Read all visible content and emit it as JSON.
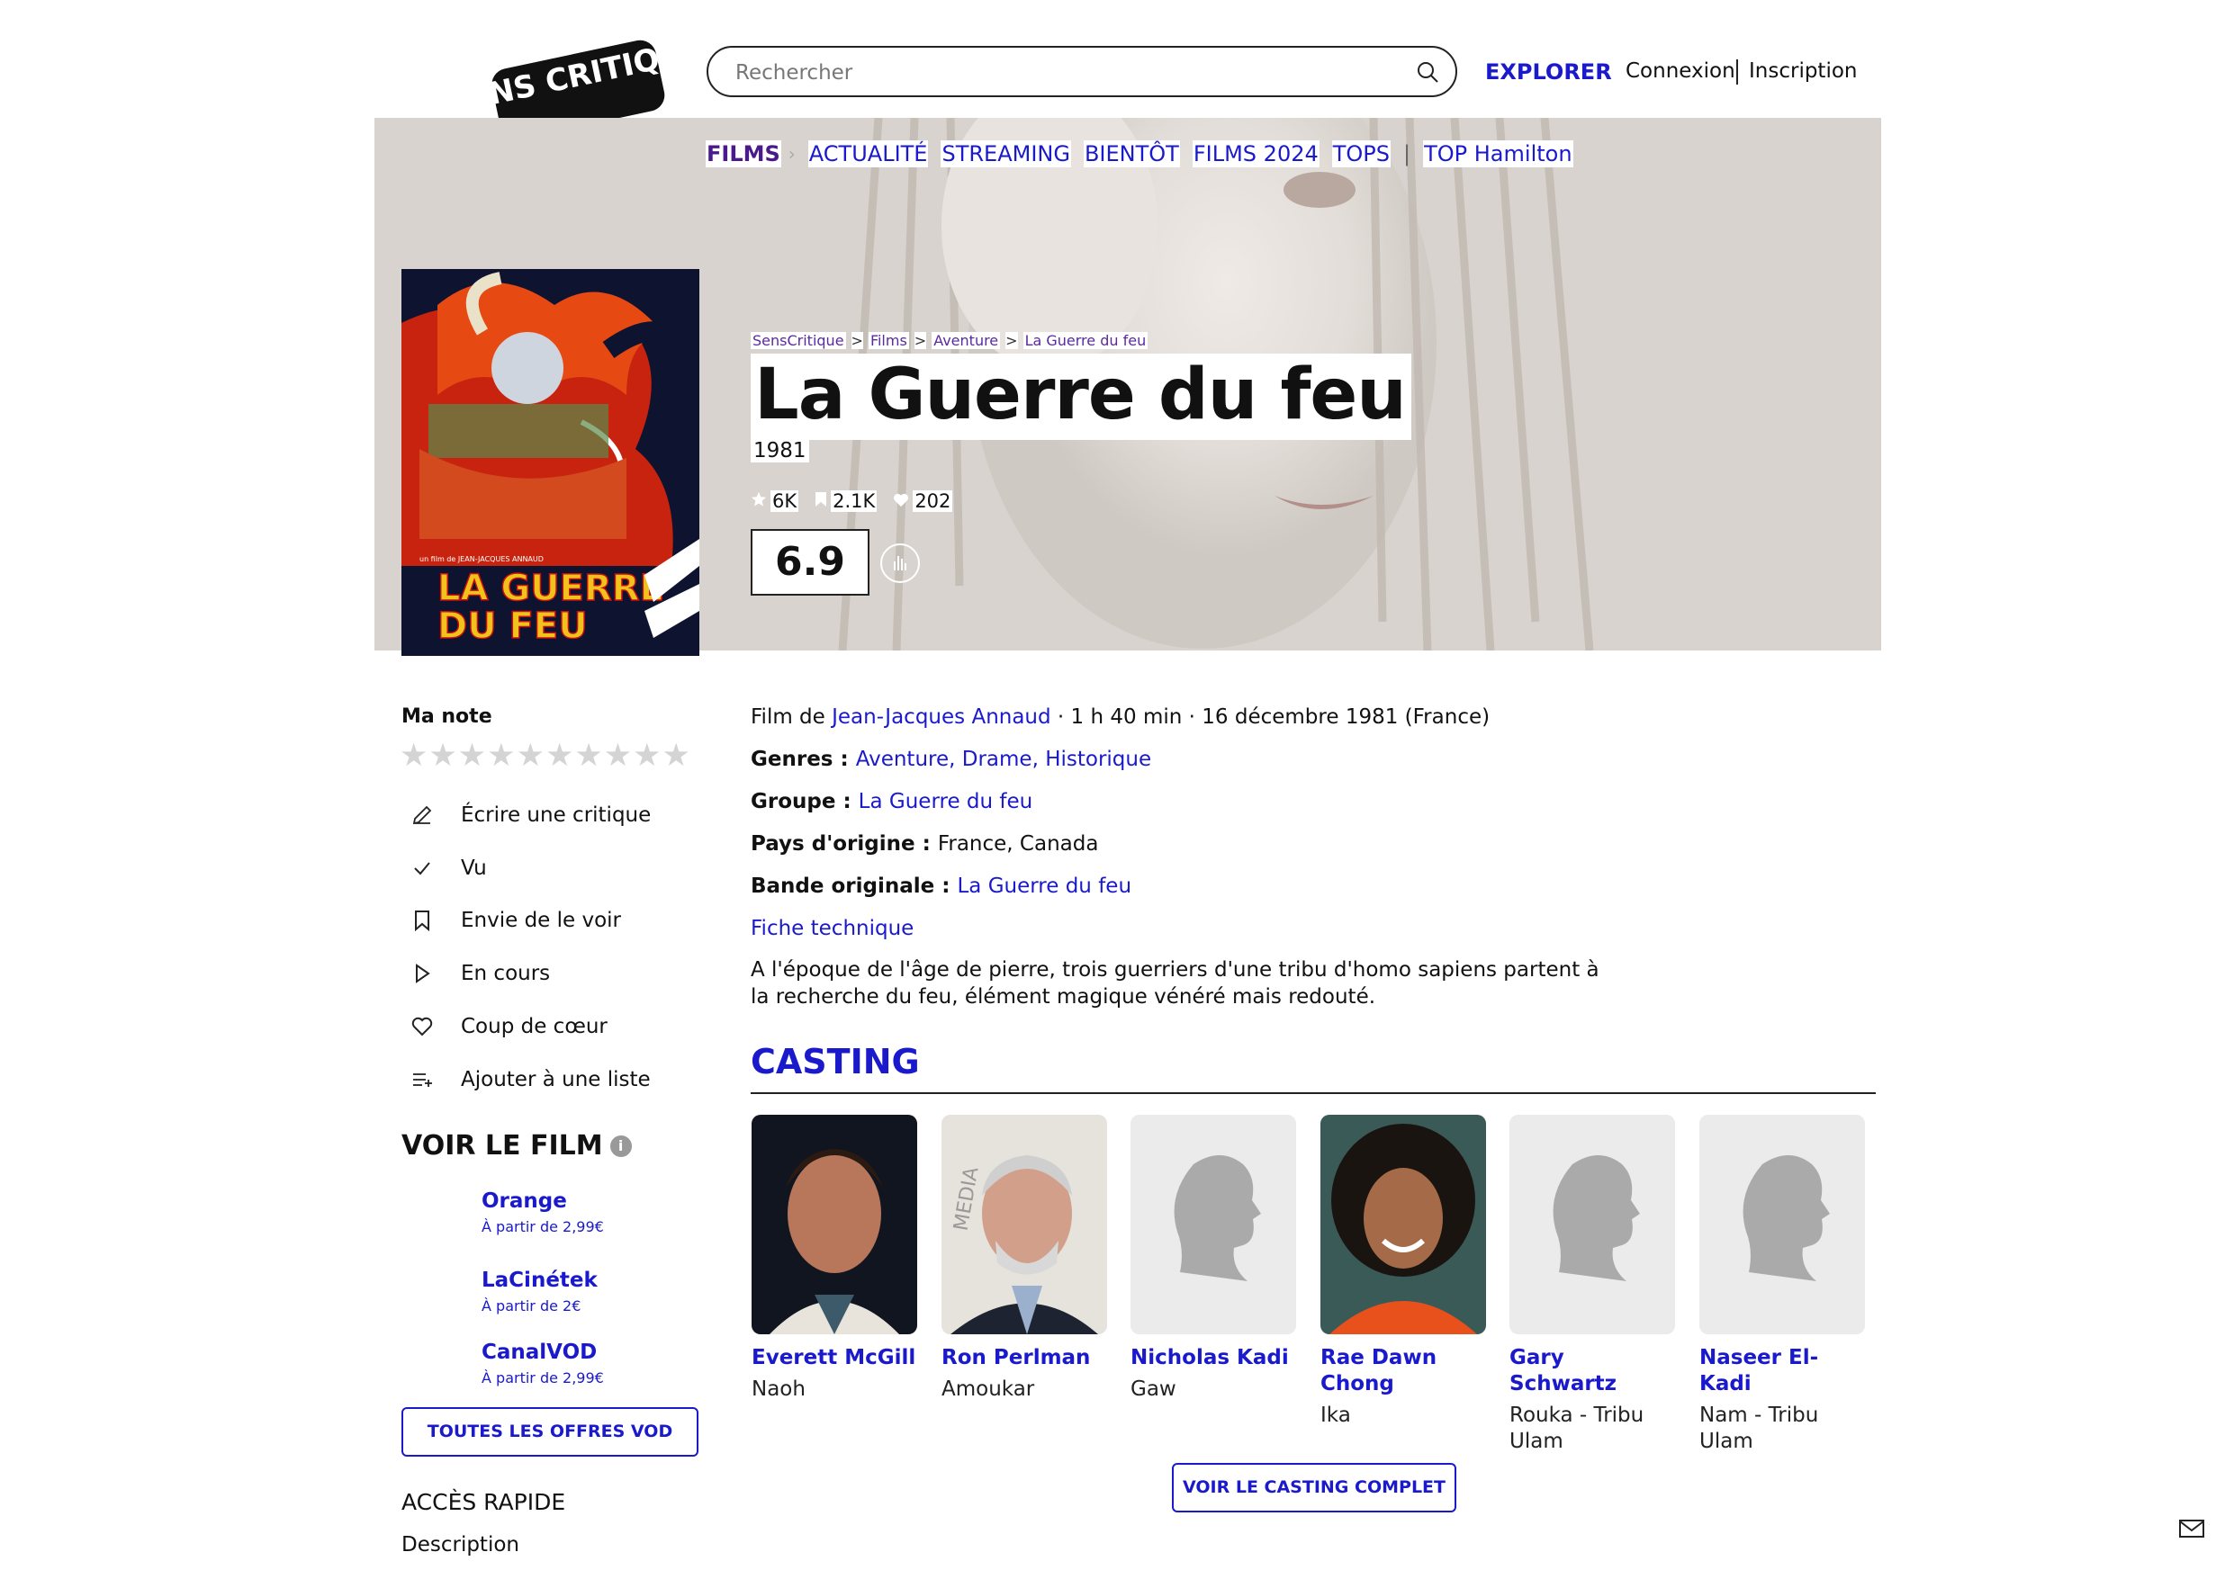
{
  "header": {
    "logo": "SENS CRITIQUE",
    "search_placeholder": "Rechercher",
    "explorer": "EXPLORER",
    "connexion": "Connexion",
    "inscription": "Inscription"
  },
  "nav": {
    "films": "FILMS",
    "items": [
      "ACTUALITÉ",
      "STREAMING",
      "BIENTÔT",
      "FILMS 2024",
      "TOPS"
    ],
    "top": "TOP Hamilton"
  },
  "breadcrumb": [
    "SensCritique",
    "Films",
    "Aventure",
    "La Guerre du feu"
  ],
  "poster": {
    "title_line1": "LA GUERRE",
    "title_line2": "DU FEU",
    "credit": "un film de JEAN-JACQUES ANNAUD"
  },
  "movie": {
    "title": "La Guerre du feu",
    "year": "1981",
    "stats": {
      "ratings": "6K",
      "wishes": "2.1K",
      "likes": "202"
    },
    "score": "6.9"
  },
  "left": {
    "ma_note": "Ma note",
    "stars_count": 10,
    "actions": [
      {
        "label": "Écrire une critique",
        "icon": "pencil-icon"
      },
      {
        "label": "Vu",
        "icon": "check-icon"
      },
      {
        "label": "Envie de le voir",
        "icon": "bookmark-icon"
      },
      {
        "label": "En cours",
        "icon": "play-icon"
      },
      {
        "label": "Coup de cœur",
        "icon": "heart-icon"
      },
      {
        "label": "Ajouter à une liste",
        "icon": "list-add-icon"
      }
    ],
    "voir_le_film": "VOIR LE FILM",
    "vod": [
      {
        "name": "Orange",
        "price": "À partir de 2,99€"
      },
      {
        "name": "LaCinétek",
        "price": "À partir de 2€"
      },
      {
        "name": "CanalVOD",
        "price": "À partir de 2,99€"
      }
    ],
    "vod_all": "TOUTES LES OFFRES VOD",
    "acces_rapide": "ACCÈS RAPIDE",
    "description": "Description"
  },
  "info": {
    "film_de_prefix": "Film de ",
    "director": "Jean-Jacques Annaud",
    "film_de_suffix": " · 1 h 40 min · 16 décembre 1981 (France)",
    "genres_label": "Genres : ",
    "genres": [
      "Aventure",
      "Drame",
      "Historique"
    ],
    "groupe_label": "Groupe : ",
    "groupe": "La Guerre du feu",
    "pays_label": "Pays d'origine : ",
    "pays": "France, Canada",
    "bo_label": "Bande originale : ",
    "bo": "La Guerre du feu",
    "fiche": "Fiche technique",
    "synopsis": "A l'époque de l'âge de pierre, trois guerriers d'une tribu d'homo sapiens partent à la recherche du feu, élément magique vénéré mais redouté."
  },
  "casting": {
    "title": "CASTING",
    "actors": [
      {
        "name": "Everett McGill",
        "role": "Naoh"
      },
      {
        "name": "Ron Perlman",
        "role": "Amoukar"
      },
      {
        "name": "Nicholas Kadi",
        "role": "Gaw"
      },
      {
        "name": "Rae Dawn Chong",
        "role": "Ika"
      },
      {
        "name": "Gary Schwartz",
        "role": "Rouka - Tribu Ulam"
      },
      {
        "name": "Naseer El-Kadi",
        "role": "Nam - Tribu Ulam"
      }
    ],
    "all": "VOIR LE CASTING COMPLET"
  },
  "colors": {
    "accent": "#1a1acc",
    "films_nav": "#4a1a8c"
  }
}
